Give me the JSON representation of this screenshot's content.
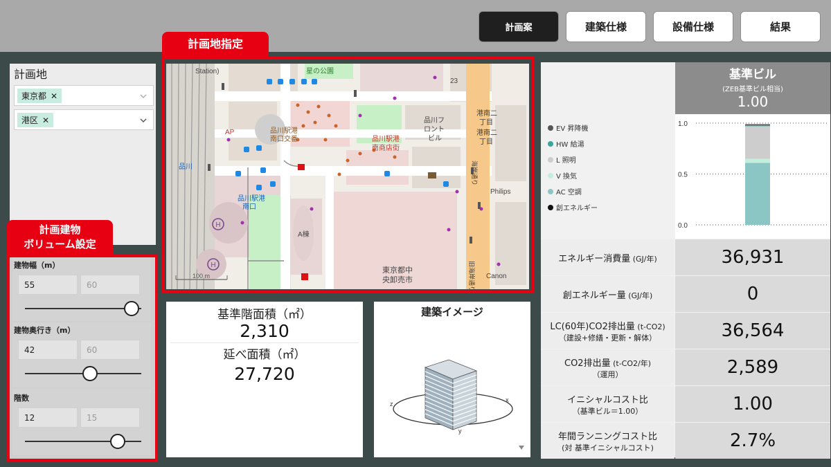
{
  "nav": {
    "buttons": [
      {
        "label": "計画案",
        "active": true
      },
      {
        "label": "建築仕様",
        "active": false
      },
      {
        "label": "設備仕様",
        "active": false
      },
      {
        "label": "結果",
        "active": false
      }
    ]
  },
  "site": {
    "title": "計画地",
    "prefecture": "東京都",
    "ward": "港区",
    "remove_symbol": "✕",
    "chevron_icon": "chevron-down-icon"
  },
  "callouts": {
    "site_spec": "計画地指定",
    "volume_line1": "計画建物",
    "volume_line2": "ボリューム設定"
  },
  "volume": {
    "width": {
      "label": "建物幅（m）",
      "value": "55",
      "max": "60",
      "level": 0.917
    },
    "depth": {
      "label": "建物奥行き（m）",
      "value": "42",
      "max": "60",
      "level": 0.56
    },
    "floors": {
      "label": "階数",
      "value": "12",
      "max": "15",
      "level": 0.8
    }
  },
  "map": {
    "labels": {
      "park": "星の公園",
      "station_top": "Station)",
      "koban_1": "品川駅港",
      "koban_2": "南口交番",
      "shopping_1": "品川駅港",
      "shopping_2": "南商店街",
      "front_1": "品川フ",
      "front_2": "ロント",
      "front_3": "ビル",
      "konan_1": "港南二",
      "konan_2": "丁目",
      "konan_3": "港南二",
      "konan_4": "丁目",
      "eki_1": "品川駅港",
      "eki_2": "南口",
      "shinagawa": "品川",
      "ap": "AP",
      "a_building": "A棟",
      "tokyo_1": "東京都中",
      "tokyo_2": "央卸売市",
      "philips": "Philips",
      "canon": "Canon",
      "num_23": "23",
      "route_1": "海岸通り",
      "route_2": "旧海岸通り",
      "scale": "100 m",
      "hospital": "H"
    }
  },
  "area": {
    "base_label": "基準階面積（㎡）",
    "base_value": "2,310",
    "total_label": "延べ面積（㎡）",
    "total_value": "27,720"
  },
  "building_image": {
    "title": "建築イメージ",
    "axis_labels": [
      "z",
      "x",
      "y"
    ]
  },
  "benchmark": {
    "title": "基準ビル",
    "subtitle": "(ZEB基準ビル相当)",
    "value": "1.00"
  },
  "chart_data": {
    "type": "bar",
    "categories": [
      "基準ビル"
    ],
    "ylim": [
      0,
      1
    ],
    "yticks": [
      "0.0",
      "0.5",
      "1.0"
    ],
    "legend_position": "left",
    "series": [
      {
        "name": "EV 昇降機",
        "color": "#555555",
        "values": [
          0.01
        ]
      },
      {
        "name": "HW 給湯",
        "color": "#3aa59f",
        "values": [
          0.01
        ]
      },
      {
        "name": "L 照明",
        "color": "#cdcdcd",
        "values": [
          0.32
        ]
      },
      {
        "name": "V 換気",
        "color": "#c4eedc",
        "values": [
          0.04
        ]
      },
      {
        "name": "AC 空調",
        "color": "#8cc6c4",
        "values": [
          0.61
        ]
      },
      {
        "name": "創エネルギー",
        "color": "#111111",
        "values": [
          0
        ]
      }
    ]
  },
  "metrics": [
    {
      "label": "エネルギー消費量",
      "unit": "(GJ/年)",
      "sub": "",
      "value": "36,931"
    },
    {
      "label": "創エネルギー量",
      "unit": "(GJ/年)",
      "sub": "",
      "value": "0"
    },
    {
      "label": "LC(60年)CO2排出量",
      "unit": "(t-CO2)",
      "sub": "（建設+修繕・更新・解体）",
      "value": "36,564"
    },
    {
      "label": "CO2排出量",
      "unit": "(t-CO2/年)",
      "sub": "（運用）",
      "value": "2,589"
    },
    {
      "label": "イニシャルコスト比",
      "unit": "",
      "sub": "（基準ビル＝1.00）",
      "value": "1.00"
    },
    {
      "label": "年間ランニングコスト比",
      "unit": "",
      "sub": "(対 基準イニシャルコスト)",
      "value": "2.7%"
    }
  ]
}
